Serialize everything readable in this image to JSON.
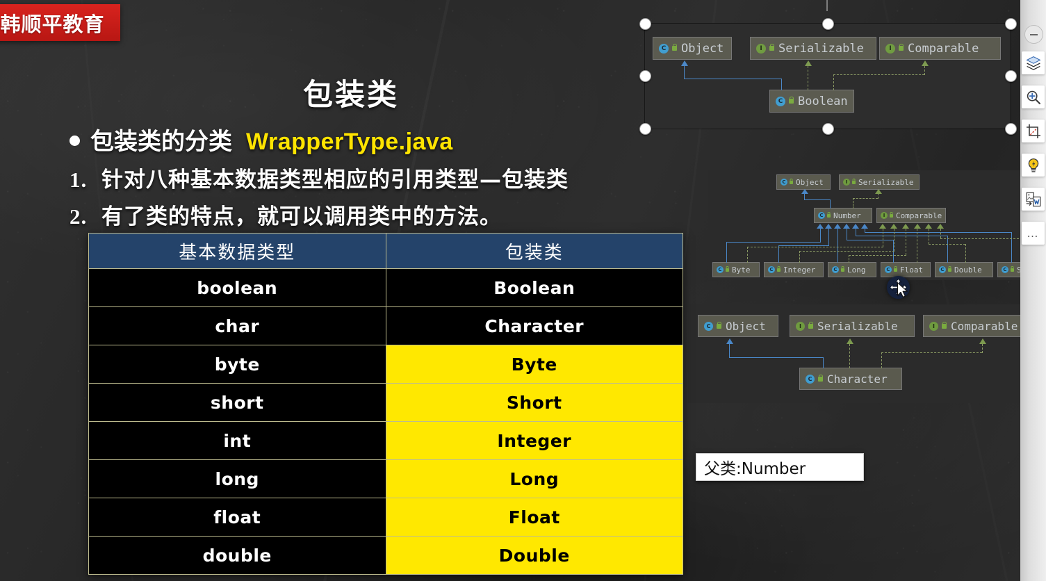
{
  "brand": {
    "banner_text": "韩顺平教育",
    "banner_color": "#c81914"
  },
  "slide": {
    "title": "包装类",
    "bullet_lead": "包装类的分类",
    "bullet_highlight": "WrapperType.java",
    "highlight_color": "#ffe400",
    "numbered": [
      {
        "num": "1.",
        "text": "针对八种基本数据类型相应的引用类型—包装类"
      },
      {
        "num": "2.",
        "text": "有了类的特点，就可以调用类中的方法。"
      }
    ]
  },
  "table": {
    "headers": [
      "基本数据类型",
      "包装类"
    ],
    "header_bg": "#24436a",
    "highlight_bg": "#ffe800",
    "rows": [
      {
        "primitive": "boolean",
        "wrapper": "Boolean",
        "highlight": false
      },
      {
        "primitive": "char",
        "wrapper": "Character",
        "highlight": false
      },
      {
        "primitive": "byte",
        "wrapper": "Byte",
        "highlight": true
      },
      {
        "primitive": "short",
        "wrapper": "Short",
        "highlight": true
      },
      {
        "primitive": "int",
        "wrapper": "Integer",
        "highlight": true
      },
      {
        "primitive": "long",
        "wrapper": "Long",
        "highlight": true
      },
      {
        "primitive": "float",
        "wrapper": "Float",
        "highlight": true
      },
      {
        "primitive": "double",
        "wrapper": "Double",
        "highlight": true
      }
    ]
  },
  "diagrams": {
    "boolean_hierarchy": {
      "nodes": {
        "object": "Object",
        "serializable": "Serializable",
        "comparable": "Comparable",
        "subject": "Boolean"
      },
      "selected": true
    },
    "number_hierarchy": {
      "nodes": {
        "object": "Object",
        "serializable": "Serializable",
        "number": "Number",
        "comparable": "Comparable",
        "byte": "Byte",
        "integer": "Integer",
        "long": "Long",
        "float": "Float",
        "double": "Double",
        "short": "Short"
      }
    },
    "character_hierarchy": {
      "nodes": {
        "object": "Object",
        "serializable": "Serializable",
        "comparable": "Comparable",
        "subject": "Character"
      }
    }
  },
  "note": {
    "text": "父类:Number"
  },
  "toolbar": {
    "collapse_label": "collapse-panel",
    "items": [
      {
        "icon": "layers-icon",
        "label": "Layers"
      },
      {
        "icon": "zoom-in-icon",
        "label": "Zoom In"
      },
      {
        "icon": "crop-icon",
        "label": "Crop"
      },
      {
        "icon": "lightbulb-icon",
        "label": "Smart Tools"
      },
      {
        "icon": "export-to-doc-icon",
        "label": "Export to Document"
      },
      {
        "icon": "more-icon",
        "label": "…"
      }
    ]
  },
  "cursor": {
    "type": "move-cursor"
  }
}
